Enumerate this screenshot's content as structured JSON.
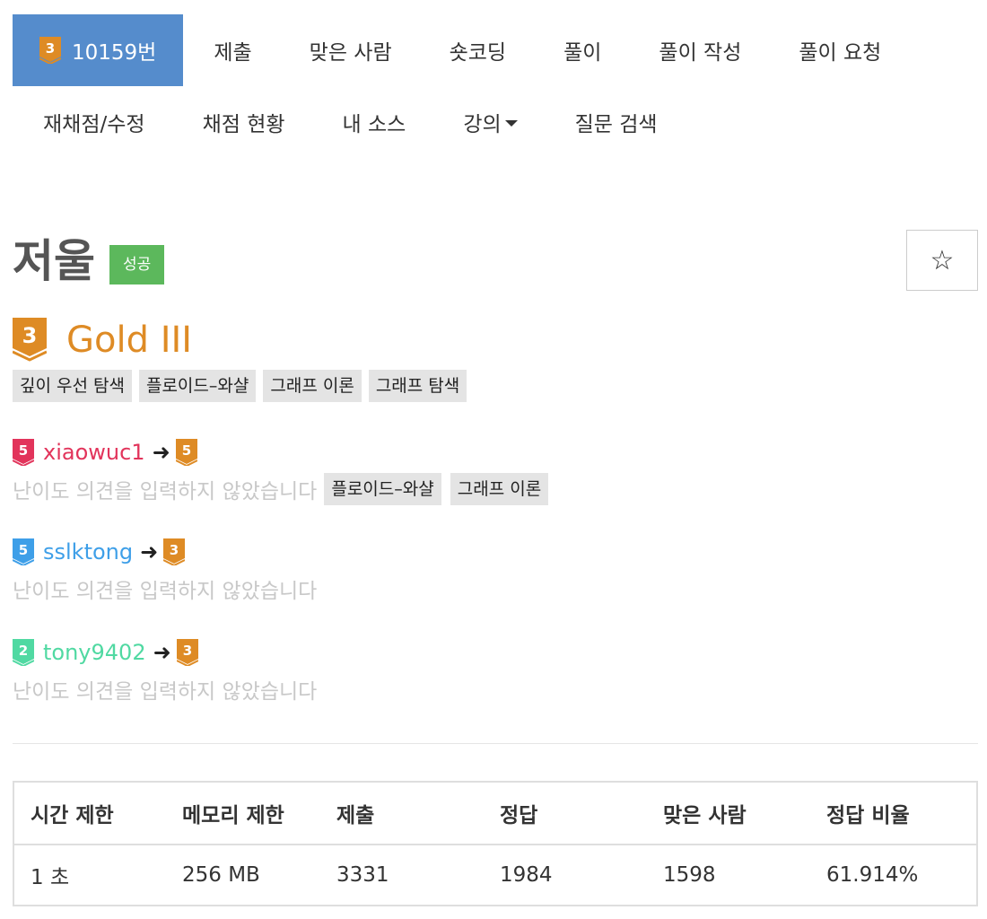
{
  "nav": {
    "problem_label": "10159번",
    "problem_tier_num": "3",
    "row1": [
      "제출",
      "맞은 사람",
      "숏코딩",
      "풀이",
      "풀이 작성",
      "풀이 요청"
    ],
    "row2": [
      "재채점/수정",
      "채점 현황",
      "내 소스",
      "강의",
      "질문 검색"
    ]
  },
  "problem": {
    "title": "저울",
    "status_badge": "성공",
    "star_symbol": "☆",
    "tier_num": "3",
    "tier_text": "Gold III",
    "tier_color": "#de8b25",
    "tags": [
      "깊이 우선 탐색",
      "플로이드–와샬",
      "그래프 이론",
      "그래프 탐색"
    ]
  },
  "contributors": [
    {
      "user": "xiaowuc1",
      "from_tier": "5",
      "from_color": "#e2345b",
      "to_tier": "5",
      "to_color": "#de8b25",
      "opinion": "난이도 의견을 입력하지 않았습니다",
      "tags": [
        "플로이드–와샬",
        "그래프 이론"
      ]
    },
    {
      "user": "sslktong",
      "from_tier": "5",
      "from_color": "#3e9fe8",
      "to_tier": "3",
      "to_color": "#de8b25",
      "opinion": "난이도 의견을 입력하지 않았습니다",
      "tags": []
    },
    {
      "user": "tony9402",
      "from_tier": "2",
      "from_color": "#50d9a2",
      "to_tier": "3",
      "to_color": "#de8b25",
      "opinion": "난이도 의견을 입력하지 않았습니다",
      "tags": []
    }
  ],
  "arrow_symbol": "➜",
  "stats": {
    "headers": [
      "시간 제한",
      "메모리 제한",
      "제출",
      "정답",
      "맞은 사람",
      "정답 비율"
    ],
    "values": [
      "1 초",
      "256 MB",
      "3331",
      "1984",
      "1598",
      "61.914%"
    ]
  }
}
